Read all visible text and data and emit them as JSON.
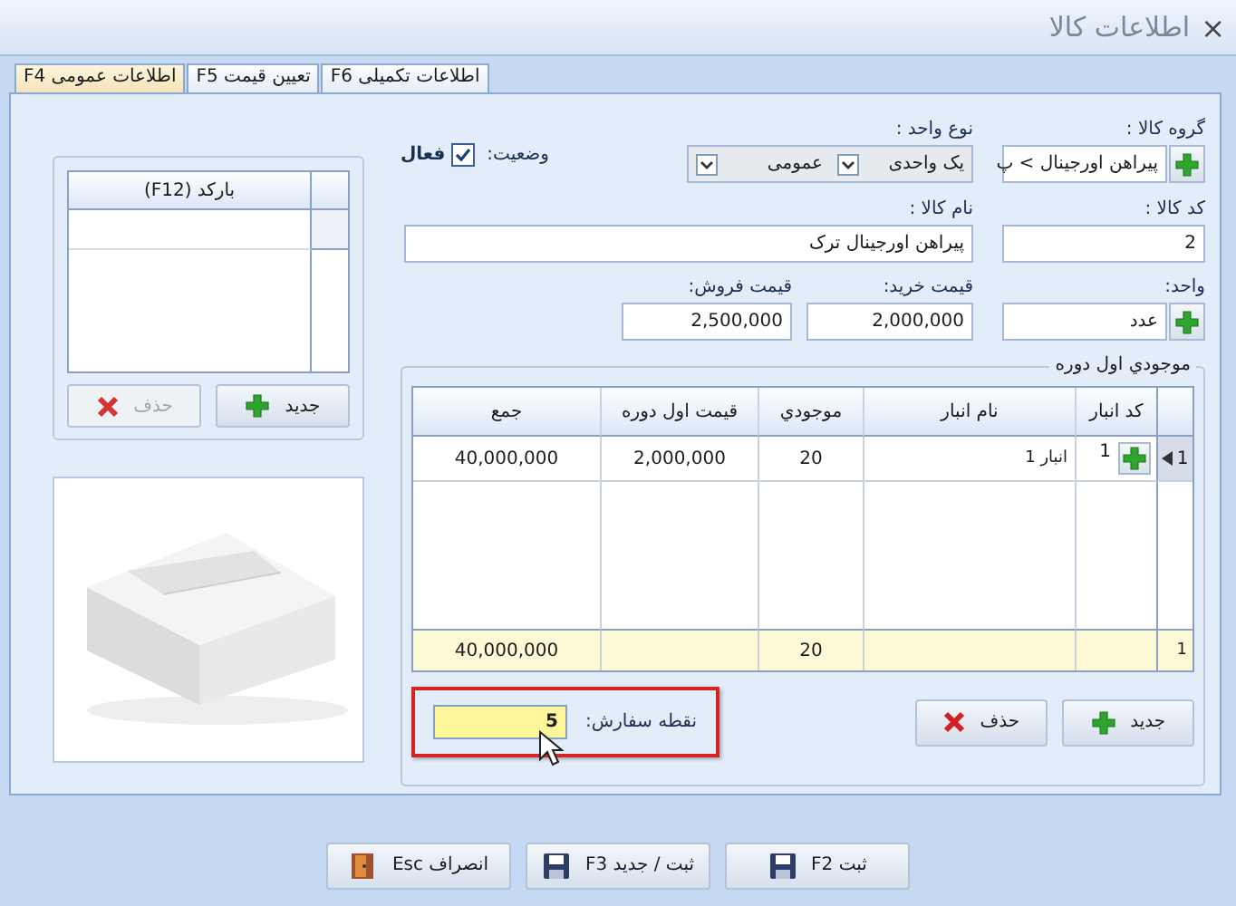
{
  "window": {
    "title": "اطلاعات کالا",
    "close": "×"
  },
  "tabs": [
    {
      "label": "اطلاعات تکمیلی F6",
      "selected": false
    },
    {
      "label": "تعیین قیمت F5",
      "selected": false
    },
    {
      "label": "اطلاعات عمومی F4",
      "selected": true
    }
  ],
  "barcode_grid": {
    "column": "بارکد (F12)"
  },
  "barcode_buttons": [
    {
      "label": "جدید",
      "kind": "add",
      "disabled": false
    },
    {
      "label": "حذف",
      "kind": "delete",
      "disabled": true
    }
  ],
  "form": {
    "group": {
      "label": "گروه کالا :",
      "value": "پیراهن اورجینال > پ"
    },
    "unit_type": {
      "label": "نوع واحد :",
      "options": [
        "یک واحدی",
        "عمومی"
      ]
    },
    "status": {
      "label": "وضعیت:",
      "checkbox_label": "فعال",
      "checked": true
    },
    "code": {
      "label": "کد کالا :",
      "value": "2"
    },
    "name": {
      "label": "نام کالا :",
      "value": "پیراهن اورجینال ترک"
    },
    "unit": {
      "label": "واحد:",
      "value": "عدد"
    },
    "buy_price": {
      "label": "قیمت خرید:",
      "value": "2,000,000"
    },
    "sell_price": {
      "label": "قیمت فروش:",
      "value": "2,500,000"
    }
  },
  "opening_stock": {
    "title": "موجودي اول دوره",
    "columns": [
      "کد انبار",
      "نام انبار",
      "موجودي",
      "قیمت اول دوره",
      "جمع"
    ],
    "rows": [
      {
        "number": "1",
        "selected": true,
        "code": "1",
        "warehouse": "انبار 1",
        "qty": "20",
        "price": "2,000,000",
        "total": "40,000,000"
      }
    ],
    "footer": {
      "count": "1",
      "qty": "20",
      "total": "40,000,000"
    },
    "buttons": [
      {
        "label": "جدید",
        "kind": "add"
      },
      {
        "label": "حذف",
        "kind": "delete"
      }
    ]
  },
  "order_point": {
    "label": "نقطه سفارش:",
    "value": "5",
    "highlighted": true
  },
  "footer_buttons": [
    {
      "label": "ثبت F2",
      "kind": "save"
    },
    {
      "label": "ثبت / جدید F3",
      "kind": "save"
    },
    {
      "label": "انصراف Esc",
      "kind": "cancel"
    }
  ]
}
